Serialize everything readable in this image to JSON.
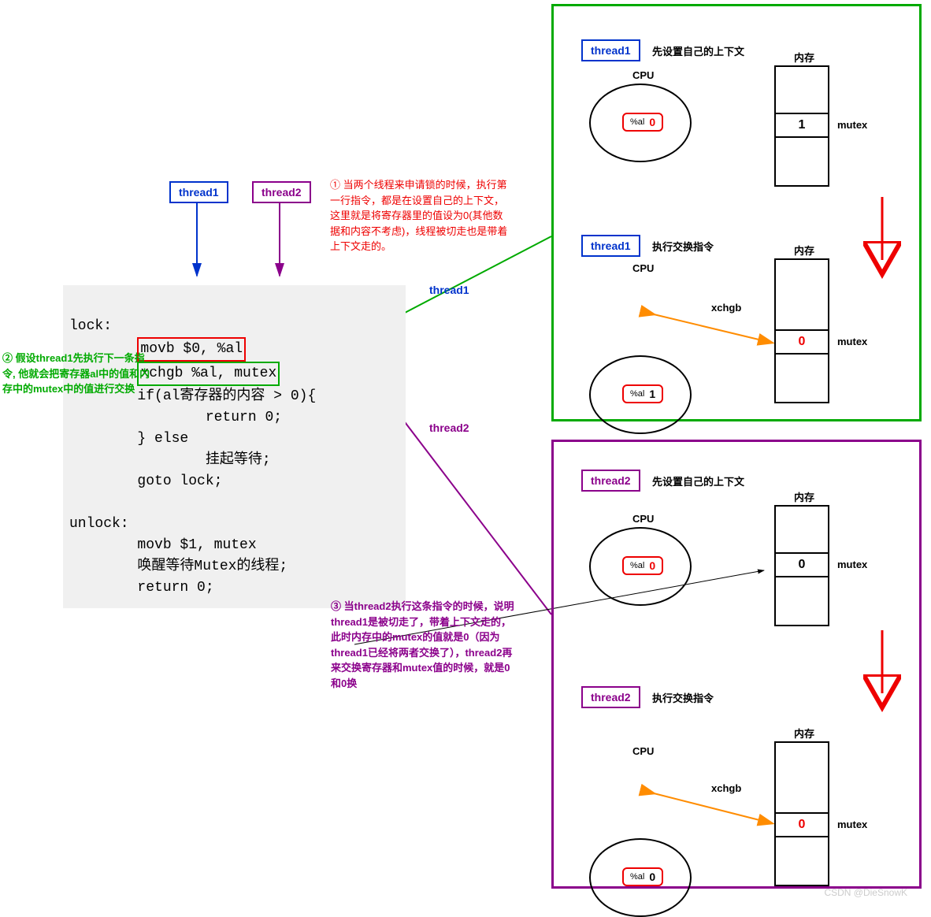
{
  "left": {
    "thread1": "thread1",
    "thread2": "thread2",
    "code": {
      "lock_label": "lock:",
      "movb": "movb $0, %al",
      "xchgb": "xchgb %al, mutex",
      "if_line": "if(al寄存器的内容 > 0){",
      "return0_a": "return 0;",
      "else_line": "} else",
      "wait": "挂起等待;",
      "goto": "goto lock;",
      "unlock_label": "unlock:",
      "movb1": "movb $1, mutex",
      "wake": "唤醒等待Mutex的线程;",
      "return0_b": "return 0;"
    },
    "note1": "① 当两个线程来申请锁的时候，执行第一行指令，都是在设置自己的上下文，这里就是将寄存器里的值设为0(其他数据和内容不考虑)，线程被切走也是带着上下文走的。",
    "note2": "② 假设thread1先执行下一条指令, 他就会把寄存器al中的值和内存中的mutex中的值进行交换",
    "note3": "③ 当thread2执行这条指令的时候，说明thread1是被切走了，带着上下文走的，此时内存中的mutex的值就是0（因为thread1已经将两者交换了），thread2再来交换寄存器和mutex值的时候，就是0和0换",
    "label_t1": "thread1",
    "label_t2": "thread2"
  },
  "panels": {
    "t1": {
      "tag": "thread1",
      "step1": "先设置自己的上下文",
      "step2": "执行交换指令",
      "cpu": "CPU",
      "mem": "内存",
      "al": "%al",
      "al_val1": "0",
      "mem_val1": "1",
      "al_val2": "1",
      "mem_val2": "0",
      "mutex": "mutex",
      "xchgb": "xchgb"
    },
    "t2": {
      "tag": "thread2",
      "step1": "先设置自己的上下文",
      "step2": "执行交换指令",
      "cpu": "CPU",
      "mem": "内存",
      "al": "%al",
      "al_val1": "0",
      "mem_val1": "0",
      "al_val2": "0",
      "mem_val2": "0",
      "mutex": "mutex",
      "xchgb": "xchgb"
    }
  },
  "watermark": "CSDN @DieSnowK"
}
